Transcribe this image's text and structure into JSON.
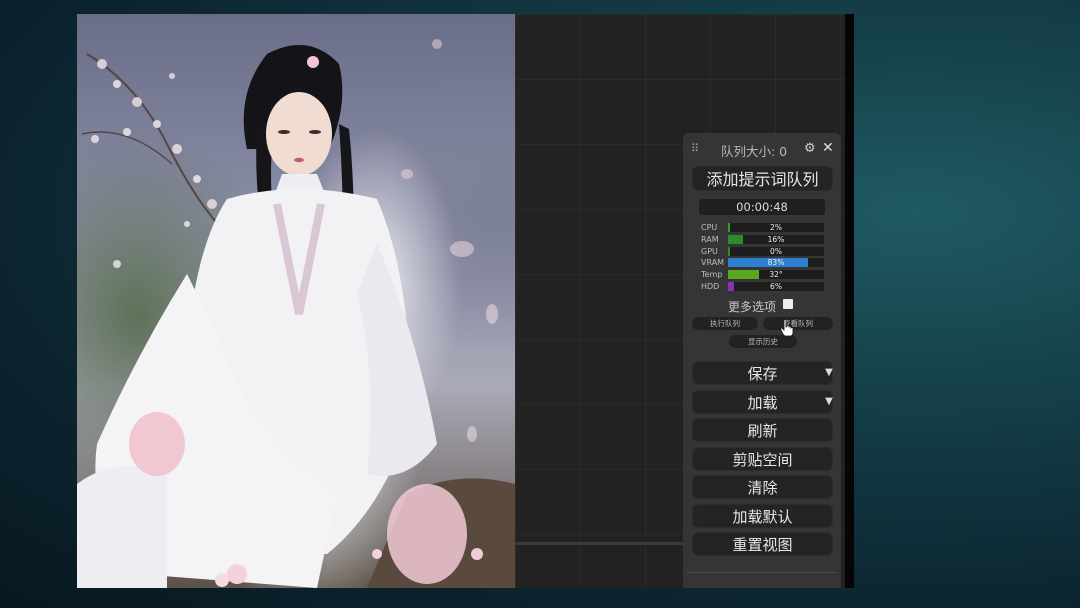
{
  "queue_panel": {
    "queue_size_label": "队列大小: 0",
    "add_prompt_queue": "添加提示词队列",
    "elapsed_time": "00:00:48",
    "stats": [
      {
        "label": "CPU",
        "value": "2%",
        "fraction": 0.02,
        "color": "#2e9e2e"
      },
      {
        "label": "RAM",
        "value": "16%",
        "fraction": 0.16,
        "color": "#2e8b2e"
      },
      {
        "label": "GPU",
        "value": "0%",
        "fraction": 0.0,
        "color": "#2e8b2e"
      },
      {
        "label": "VRAM",
        "value": "83%",
        "fraction": 0.83,
        "color": "#2f7fd0"
      },
      {
        "label": "Temp",
        "value": "32°",
        "fraction": 0.32,
        "color": "#5aa81e"
      },
      {
        "label": "HDD",
        "value": "6%",
        "fraction": 0.06,
        "color": "#8a2fb8"
      }
    ],
    "more_options": "更多选项",
    "more_options_checked": false,
    "execute_queue": "执行队列",
    "view_queue": "查看队列",
    "show_history": "显示历史",
    "save": "保存",
    "load": "加载",
    "refresh": "刷新",
    "clipspace": "剪贴空间",
    "clear": "清除",
    "load_default": "加载默认",
    "reset_view": "重置视图"
  },
  "icons": {
    "drag": "drag-handle-icon",
    "settings": "gear-icon",
    "close": "close-icon",
    "dropdown": "chevron-down-icon"
  }
}
